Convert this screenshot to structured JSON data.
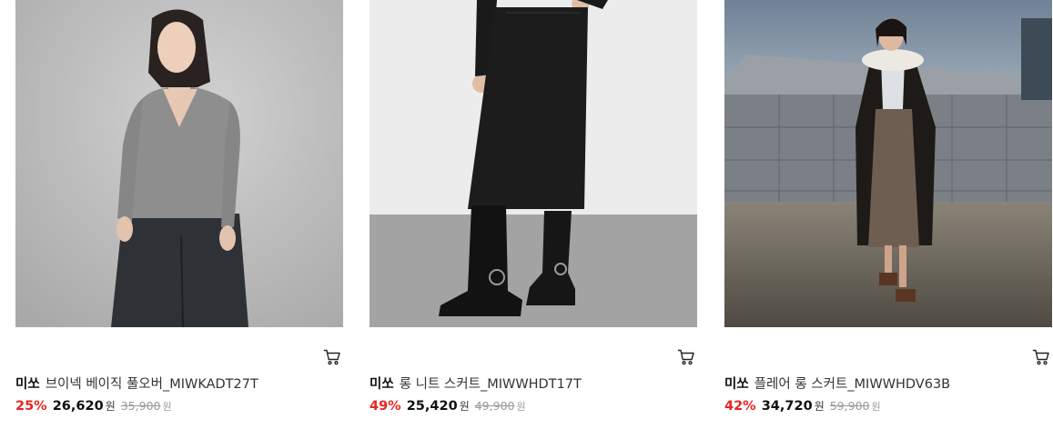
{
  "products": [
    {
      "brand": "미쏘",
      "name": "브이넥 베이직 풀오버_MIWKADT27T",
      "discount": "25%",
      "sale_price": "26,620",
      "original_price": "35,900",
      "currency": "원",
      "image": "woman-grey-vneck-sweater-photo"
    },
    {
      "brand": "미쏘",
      "name": "롱 니트 스커트_MIWWHDT17T",
      "discount": "49%",
      "sale_price": "25,420",
      "original_price": "49,900",
      "currency": "원",
      "image": "black-knit-skirt-boots-photo"
    },
    {
      "brand": "미쏘",
      "name": "플레어 롱 스커트_MIWWHDV63B",
      "discount": "42%",
      "sale_price": "34,720",
      "original_price": "59,900",
      "currency": "원",
      "image": "woman-coat-flare-skirt-rooftop-photo"
    }
  ],
  "icons": {
    "cart": "shopping-cart-icon"
  },
  "colors": {
    "discount": "#e8241f",
    "strike": "#999999"
  }
}
